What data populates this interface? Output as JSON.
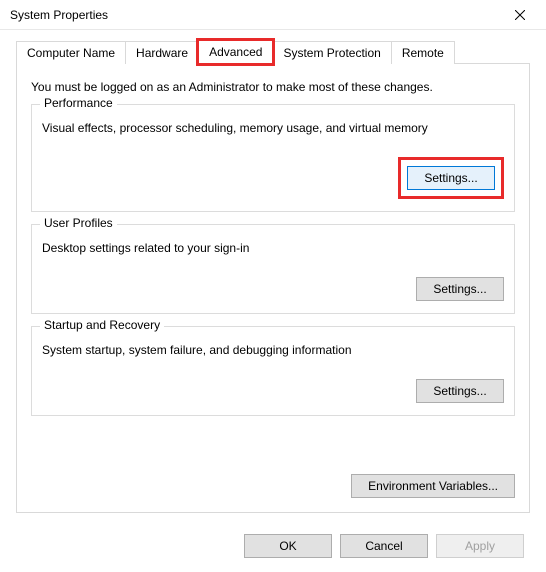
{
  "window": {
    "title": "System Properties"
  },
  "tabs": {
    "computer_name": "Computer Name",
    "hardware": "Hardware",
    "advanced": "Advanced",
    "system_protection": "System Protection",
    "remote": "Remote"
  },
  "admin_note": "You must be logged on as an Administrator to make most of these changes.",
  "performance": {
    "legend": "Performance",
    "desc": "Visual effects, processor scheduling, memory usage, and virtual memory",
    "button": "Settings..."
  },
  "user_profiles": {
    "legend": "User Profiles",
    "desc": "Desktop settings related to your sign-in",
    "button": "Settings..."
  },
  "startup": {
    "legend": "Startup and Recovery",
    "desc": "System startup, system failure, and debugging information",
    "button": "Settings..."
  },
  "env_vars_button": "Environment Variables...",
  "buttons": {
    "ok": "OK",
    "cancel": "Cancel",
    "apply": "Apply"
  }
}
